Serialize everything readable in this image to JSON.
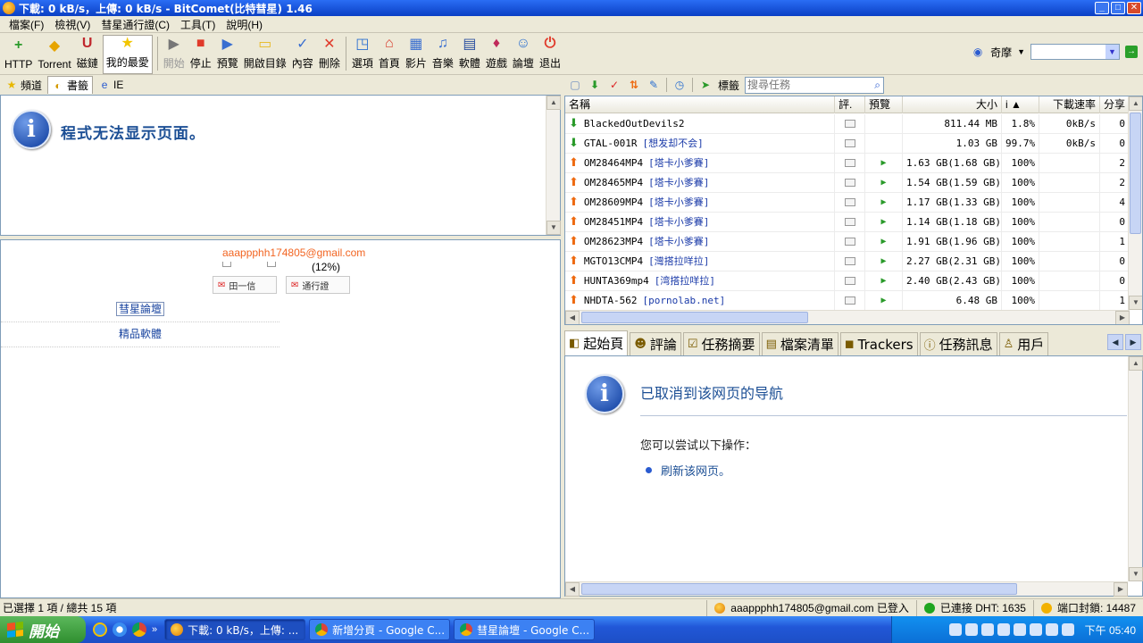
{
  "window": {
    "title": "下載: 0 kB/s，上傳: 0 kB/s - BitComet(比特彗星) 1.46",
    "min": "_",
    "max": "□",
    "close": "✕"
  },
  "menu": [
    "檔案(F)",
    "檢視(V)",
    "彗星通行證(C)",
    "工具(T)",
    "說明(H)"
  ],
  "toolbar": {
    "buttons": [
      {
        "label": "HTTP",
        "icon": "http-add-icon",
        "color": "#2a9a2a",
        "glyph": "+"
      },
      {
        "label": "Torrent",
        "icon": "torrent-icon",
        "color": "#e6a400",
        "glyph": "◆"
      },
      {
        "label": "磁鏈",
        "icon": "magnet-icon",
        "color": "#c0282d",
        "glyph": "U"
      },
      {
        "label": "我的最愛",
        "icon": "star-icon",
        "color": "#f2c500",
        "glyph": "★",
        "active": true
      },
      {
        "label": "開始",
        "icon": "play-icon",
        "color": "#777",
        "glyph": "▶",
        "disabled": true
      },
      {
        "label": "停止",
        "icon": "stop-icon",
        "color": "#e03a2a",
        "glyph": "■"
      },
      {
        "label": "預覽",
        "icon": "preview-icon",
        "color": "#3a6fd0",
        "glyph": "▶"
      },
      {
        "label": "開啟目錄",
        "icon": "folder-icon",
        "color": "#e8b820",
        "glyph": "▭"
      },
      {
        "label": "內容",
        "icon": "properties-icon",
        "color": "#3a6fd0",
        "glyph": "✓"
      },
      {
        "label": "刪除",
        "icon": "delete-icon",
        "color": "#e03a2a",
        "glyph": "✕"
      },
      {
        "label": "選項",
        "icon": "options-icon",
        "color": "#2a6fd0",
        "glyph": "◳"
      },
      {
        "label": "首頁",
        "icon": "home-icon",
        "color": "#d83a2a",
        "glyph": "⌂"
      },
      {
        "label": "影片",
        "icon": "video-icon",
        "color": "#3a6fd0",
        "glyph": "▦"
      },
      {
        "label": "音樂",
        "icon": "music-icon",
        "color": "#3a6fd0",
        "glyph": "♫"
      },
      {
        "label": "軟體",
        "icon": "software-icon",
        "color": "#2a4fa0",
        "glyph": "▤"
      },
      {
        "label": "遊戲",
        "icon": "game-icon",
        "color": "#c02a5a",
        "glyph": "♦"
      },
      {
        "label": "論壇",
        "icon": "forum-icon",
        "color": "#2a6fd0",
        "glyph": "☺"
      },
      {
        "label": "退出",
        "icon": "exit-icon",
        "color": "#e03a2a",
        "glyph": "⏻"
      }
    ],
    "search_provider": "奇摩",
    "go": "→"
  },
  "left_tabs": [
    {
      "label": "頻道",
      "icon": "star-icon"
    },
    {
      "label": "書籤",
      "icon": "bookmark-icon",
      "active": true
    },
    {
      "label": "IE",
      "icon": "ie-icon"
    }
  ],
  "browser": {
    "error_title": "程式无法显示页面。",
    "info_glyph": "i"
  },
  "account": {
    "email": "aaappphh174805@gmail.com",
    "percent": "(12%)",
    "btn_mail": "田一信",
    "btn_pass": "通行證",
    "links": [
      "彗星論壇",
      "精品軟體"
    ]
  },
  "right_toolbar": {
    "tags_label": "標籤",
    "search_placeholder": "搜尋任務"
  },
  "tasks": {
    "columns": [
      "名稱",
      "評.",
      "預覽",
      "大小",
      "i ▲",
      "下載速率",
      "分享"
    ],
    "rows": [
      {
        "dir": "down",
        "name": "BlackedOutDevils2",
        "tag": "",
        "preview": "",
        "size": "811.44 MB",
        "pct": "1.8%",
        "speed": "0kB/s",
        "share": "0"
      },
      {
        "dir": "down",
        "name": "GTAL-001R",
        "tag": "[想发却不会]",
        "preview": "",
        "size": "1.03 GB",
        "pct": "99.7%",
        "speed": "0kB/s",
        "share": "0"
      },
      {
        "dir": "up",
        "name": "OM28464MP4",
        "tag": "[塔卡小爹賽]",
        "preview": "▶",
        "size": "1.63 GB(1.68 GB)",
        "pct": "100%",
        "speed": "",
        "share": "2"
      },
      {
        "dir": "up",
        "name": "OM28465MP4",
        "tag": "[塔卡小爹賽]",
        "preview": "▶",
        "size": "1.54 GB(1.59 GB)",
        "pct": "100%",
        "speed": "",
        "share": "2"
      },
      {
        "dir": "up",
        "name": "OM28609MP4",
        "tag": "[塔卡小爹賽]",
        "preview": "▶",
        "size": "1.17 GB(1.33 GB)",
        "pct": "100%",
        "speed": "",
        "share": "4"
      },
      {
        "dir": "up",
        "name": "OM28451MP4",
        "tag": "[塔卡小爹賽]",
        "preview": "▶",
        "size": "1.14 GB(1.18 GB)",
        "pct": "100%",
        "speed": "",
        "share": "0"
      },
      {
        "dir": "up",
        "name": "OM28623MP4",
        "tag": "[塔卡小爹賽]",
        "preview": "▶",
        "size": "1.91 GB(1.96 GB)",
        "pct": "100%",
        "speed": "",
        "share": "1"
      },
      {
        "dir": "up",
        "name": "MGTO13CMP4",
        "tag": "[灣搭拉咩拉]",
        "preview": "▶",
        "size": "2.27 GB(2.31 GB)",
        "pct": "100%",
        "speed": "",
        "share": "0"
      },
      {
        "dir": "up",
        "name": "HUNTA369mp4",
        "tag": "[湾搭拉咩拉]",
        "preview": "▶",
        "size": "2.40 GB(2.43 GB)",
        "pct": "100%",
        "speed": "",
        "share": "0"
      },
      {
        "dir": "up",
        "name": "NHDTA-562",
        "tag": "[pornolab.net]",
        "preview": "▶",
        "size": "6.48 GB",
        "pct": "100%",
        "speed": "",
        "share": "1"
      }
    ]
  },
  "bottom_tabs": [
    {
      "label": "起始頁",
      "active": true,
      "icon": "startpage-icon"
    },
    {
      "label": "評論",
      "icon": "comment-icon"
    },
    {
      "label": "任務摘要",
      "icon": "summary-icon"
    },
    {
      "label": "檔案清單",
      "icon": "filelist-icon"
    },
    {
      "label": "Trackers",
      "icon": "trackers-icon"
    },
    {
      "label": "任務訊息",
      "icon": "taskinfo-icon"
    },
    {
      "label": "用戶",
      "icon": "user-icon"
    }
  ],
  "startpage": {
    "title": "已取消到该网页的导航",
    "try_text": "您可以尝试以下操作：",
    "refresh": "刷新该网页。"
  },
  "status": {
    "selection": "已選擇 1 項 / 總共 15 項",
    "login": "aaappphh174805@gmail.com 已登入",
    "dht": "已連接 DHT: 1635",
    "port": "端口封鎖: 14487"
  },
  "taskbar": {
    "start": "開始",
    "tasks": [
      {
        "label": "下載: 0 kB/s，上傳: ...",
        "active": true
      },
      {
        "label": "新增分頁 - Google C..."
      },
      {
        "label": "彗星論壇 - Google C..."
      }
    ],
    "time": "下午 05:40"
  },
  "colors": {
    "title_blue": "#0a3fc4",
    "email_orange": "#f26522",
    "link_blue": "#1a3aa8",
    "dht_green": "#1fa51f",
    "port_yellow": "#f2b100"
  }
}
